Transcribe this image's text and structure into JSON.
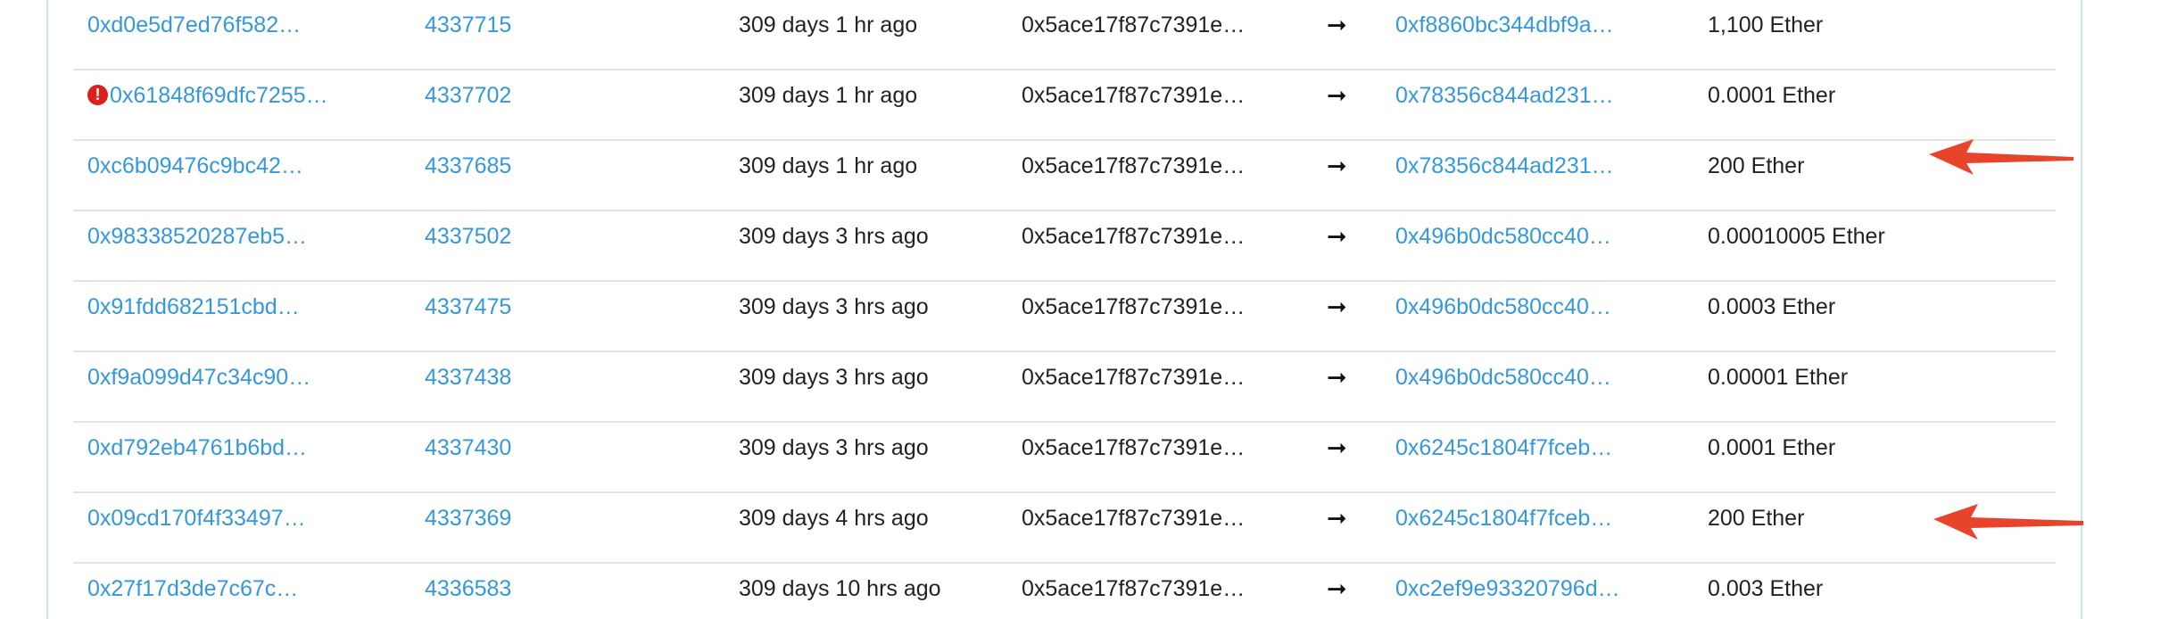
{
  "transactions": {
    "rows": [
      {
        "hash": "0xd0e5d7ed76f582…",
        "block": "4337715",
        "age": "309 days 1 hr ago",
        "from": "0x5ace17f87c7391e…",
        "to": "0xf8860bc344dbf9a…",
        "value": "1,100 Ether",
        "error": false
      },
      {
        "hash": "0x61848f69dfc7255…",
        "block": "4337702",
        "age": "309 days 1 hr ago",
        "from": "0x5ace17f87c7391e…",
        "to": "0x78356c844ad231…",
        "value": "0.0001 Ether",
        "error": true
      },
      {
        "hash": "0xc6b09476c9bc42…",
        "block": "4337685",
        "age": "309 days 1 hr ago",
        "from": "0x5ace17f87c7391e…",
        "to": "0x78356c844ad231…",
        "value": "200 Ether",
        "error": false
      },
      {
        "hash": "0x98338520287eb5…",
        "block": "4337502",
        "age": "309 days 3 hrs ago",
        "from": "0x5ace17f87c7391e…",
        "to": "0x496b0dc580cc40…",
        "value": "0.00010005 Ether",
        "error": false
      },
      {
        "hash": "0x91fdd682151cbd…",
        "block": "4337475",
        "age": "309 days 3 hrs ago",
        "from": "0x5ace17f87c7391e…",
        "to": "0x496b0dc580cc40…",
        "value": "0.0003 Ether",
        "error": false
      },
      {
        "hash": "0xf9a099d47c34c90…",
        "block": "4337438",
        "age": "309 days 3 hrs ago",
        "from": "0x5ace17f87c7391e…",
        "to": "0x496b0dc580cc40…",
        "value": "0.00001 Ether",
        "error": false
      },
      {
        "hash": "0xd792eb4761b6bd…",
        "block": "4337430",
        "age": "309 days 3 hrs ago",
        "from": "0x5ace17f87c7391e…",
        "to": "0x6245c1804f7fceb…",
        "value": "0.0001 Ether",
        "error": false
      },
      {
        "hash": "0x09cd170f4f33497…",
        "block": "4337369",
        "age": "309 days 4 hrs ago",
        "from": "0x5ace17f87c7391e…",
        "to": "0x6245c1804f7fceb…",
        "value": "200 Ether",
        "error": false
      },
      {
        "hash": "0x27f17d3de7c67c…",
        "block": "4336583",
        "age": "309 days 10 hrs ago",
        "from": "0x5ace17f87c7391e…",
        "to": "0xc2ef9e93320796d…",
        "value": "0.003 Ether",
        "error": false
      }
    ],
    "direction_glyph": "➞",
    "error_glyph": "!"
  },
  "colors": {
    "link": "#3498db",
    "text": "#222222",
    "error": "#d9211e",
    "annotation_arrow": "#e8432b",
    "divider": "#e3e3e3",
    "panel_border": "#cfe3f0"
  },
  "annotations": {
    "highlighted_rows": [
      2,
      7
    ]
  }
}
